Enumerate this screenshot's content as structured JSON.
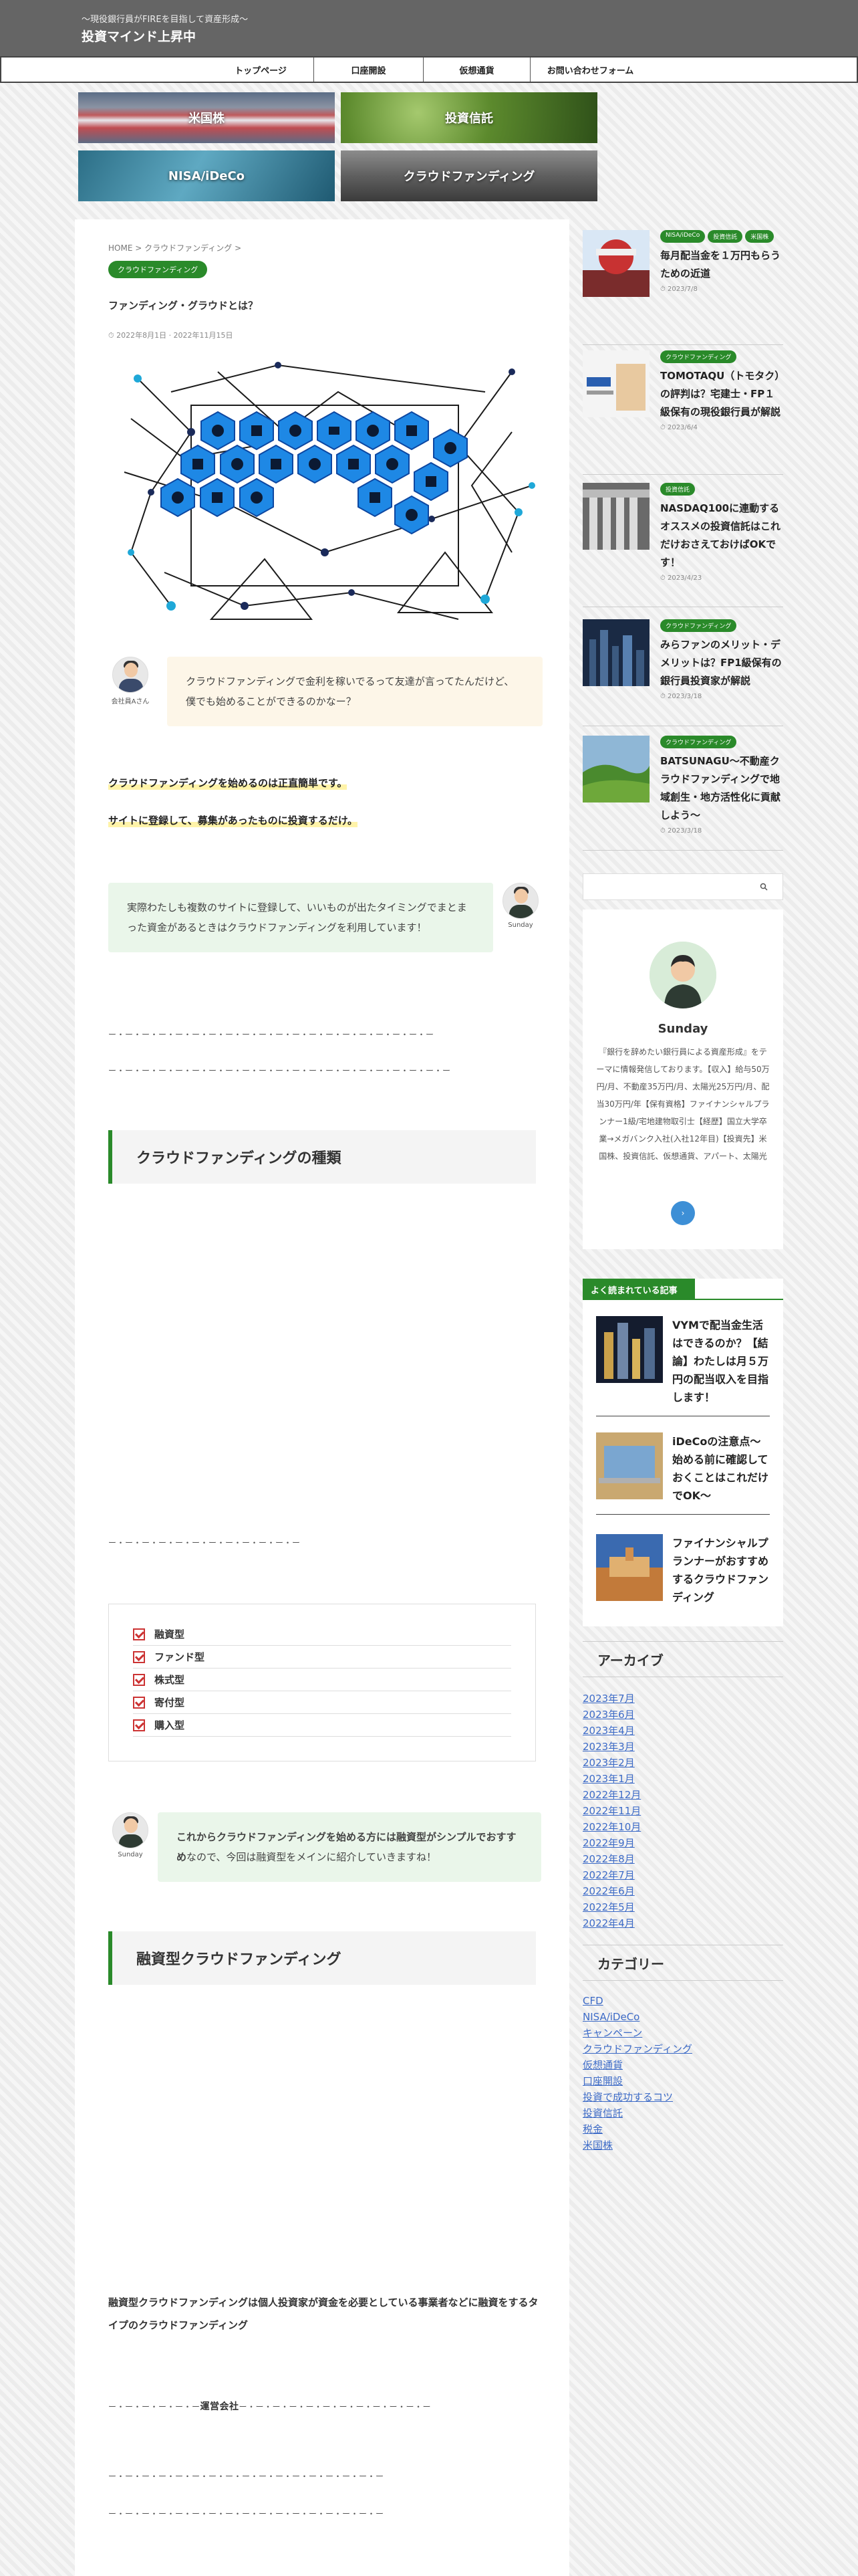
{
  "header": {
    "tagline": "〜現役銀行員がFIREを目指して資産形成〜",
    "title": "投資マインド上昇中"
  },
  "nav": [
    "トップページ",
    "口座開設",
    "仮想通貨",
    "お問い合わせフォーム"
  ],
  "categories": [
    "米国株",
    "投資信託",
    "NISA/iDeCo",
    "クラウドファンディング"
  ],
  "article": {
    "breadcrumb": "HOME > クラウドファンディング >",
    "category": "クラウドファンディング",
    "title": "ファンディング・グラウドとは？",
    "dates": "2022年8月1日 · 2022年11月15日",
    "q_avatar": "会社員Aさん",
    "q_text": "クラウドファンディングで金利を稼いでるって友達が言ってたんだけど、僕でも始めることができるのかなー？",
    "hl1": "クラウドファンディングを始めるのは正直簡単です。",
    "hl2": "サイトに登録して、募集があったものに投資するだけ。",
    "a_text": "実際わたしも複数のサイトに登録して、いいものが出たタイミングでまとまった資金があるときはクラウドファンディングを利用しています！",
    "a_avatar": "Sunday",
    "small1": "ー・ー・ー・ー・ー・ー・ー・ー・ー・ー・ー・ー・ー・ー・ー・ー・ー・ー・ー・ー",
    "small2": "ー・ー・ー・ー・ー・ー・ー・ー・ー・ー・ー・ー・ー・ー・ー・ー・ー・ー・ー・ー・ー",
    "h2_1": "クラウドファンディングの種類",
    "small3": "ー・ー・ー・ー・ー・ー・ー・ー・ー・ー・ー・ー",
    "types": [
      "融資型",
      "ファンド型",
      "株式型",
      "寄付型",
      "購入型"
    ],
    "a2_text_bold": "これからクラウドファンディングを始める方には融資型がシンプルでおすすめ",
    "a2_text_rest": "なので、今回は融資型をメインに紹介していきますね！",
    "h2_2": "融資型クラウドファンディング",
    "para1": "融資型クラウドファンディングは個人投資家が資金を必要としている事業者などに融資をするタイプのクラウドファンディング",
    "para2_pre": "ー・ー・ー・ー・ー・ー",
    "para2_bold": "運営会社",
    "para2_post": "ー・ー・ー・ー・ー・ー・ー・ー・ー・ー・ー・ー",
    "small4": "ー・ー・ー・ー・ー・ー・ー・ー・ー・ー・ー・ー・ー・ー・ー・ー・ー",
    "small5": "ー・ー・ー・ー・ー・ー・ー・ー・ー・ー・ー・ー・ー・ー・ー・ー・ー"
  },
  "recent": [
    {
      "badges": [
        "NISA/iDeCo",
        "投資信託",
        "米国株"
      ],
      "title": "毎月配当金を１万円もらうための近道",
      "date": "2023/7/8"
    },
    {
      "badges": [
        "クラウドファンディング"
      ],
      "title": "TOMOTAQU（トモタク）の評判は？宅建士・FP１級保有の現役銀行員が解説",
      "date": "2023/6/4"
    },
    {
      "badges": [
        "投資信託"
      ],
      "title": "NASDAQ100に連動するオススメの投資信託はこれだけおさえておけばOKです！",
      "date": "2023/4/23"
    },
    {
      "badges": [
        "クラウドファンディング"
      ],
      "title": "みらファンのメリット・デメリットは？FP1級保有の銀行員投資家が解説",
      "date": "2023/3/18"
    },
    {
      "badges": [
        "クラウドファンディング"
      ],
      "title": "BATSUNAGU〜不動産クラウドファンディングで地域創生・地方活性化に貢献しよう〜",
      "date": "2023/3/18"
    }
  ],
  "profile": {
    "name": "Sunday",
    "desc": "『銀行を辞めたい銀行員による資産形成』をテーマに情報発信しております。【収入】給与50万円/月、不動産35万円/月、太陽光25万円/月、配当30万円/年【保有資格】ファイナンシャルプランナー1級/宅地建物取引士【経歴】国立大学卒業→メガバンク入社(入社12年目)【投資先】米国株、投資信託、仮想通貨、アパート、太陽光",
    "more": "›"
  },
  "popular": {
    "heading": "よく読まれている記事",
    "items": [
      "VYMで配当金生活はできるのか？【結論】わたしは月５万円の配当収入を目指します！",
      "iDeCoの注意点〜始める前に確認しておくことはこれだけでOK〜",
      "ファイナンシャルプランナーがおすすめするクラウドファンディング"
    ]
  },
  "archive": {
    "heading": "アーカイブ",
    "items": [
      "2023年7月",
      "2023年6月",
      "2023年4月",
      "2023年3月",
      "2023年2月",
      "2023年1月",
      "2022年12月",
      "2022年11月",
      "2022年10月",
      "2022年9月",
      "2022年8月",
      "2022年7月",
      "2022年6月",
      "2022年5月",
      "2022年4月"
    ]
  },
  "category_list": {
    "heading": "カテゴリー",
    "items": [
      "CFD",
      "NISA/iDeCo",
      "キャンペーン",
      "クラウドファンディング",
      "仮想通貨",
      "口座開設",
      "投資で成功するコツ",
      "投資信託",
      "税金",
      "米国株"
    ]
  },
  "colors": {
    "accent": "#2a8a2a",
    "header": "#656565",
    "link": "#3d6bc7"
  }
}
